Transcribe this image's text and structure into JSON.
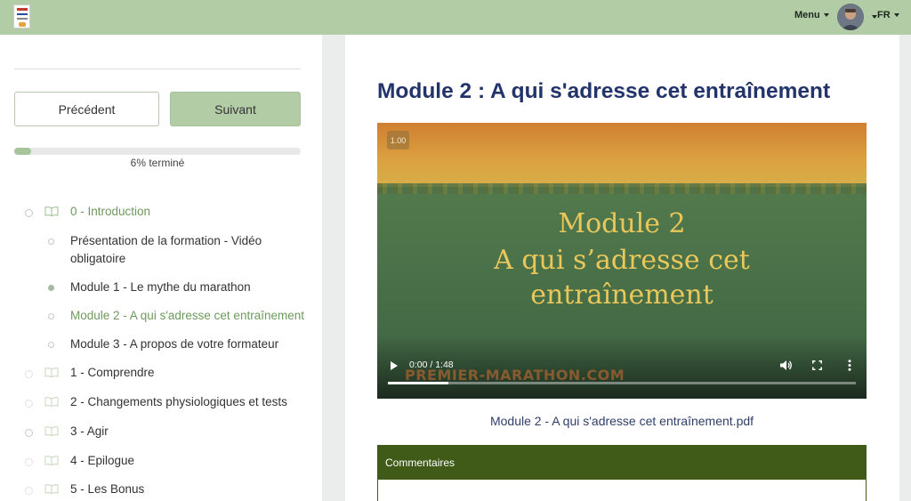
{
  "header": {
    "logo_icon": "course-logo",
    "menu_label": "Menu",
    "language": "FR",
    "bar_color": "#b2cca5"
  },
  "nav": {
    "prev_label": "Précédent",
    "next_label": "Suivant"
  },
  "progress": {
    "fraction": 0.06,
    "label": "6% terminé"
  },
  "curriculum": [
    {
      "label": "0 - Introduction",
      "state": "section"
    },
    {
      "label": "Présentation de la formation - Vidéo",
      "label_line2": "obligatoire",
      "state": "lesson"
    },
    {
      "label": "Module 1 - Le mythe du marathon",
      "state": "completed"
    },
    {
      "label": "Module 2 - A qui s'adresse cet entraînement",
      "state": "current"
    },
    {
      "label": "Module 3 - A propos de votre formateur",
      "state": "lesson"
    },
    {
      "label": "1 - Comprendre",
      "state": "section"
    },
    {
      "label": "2 - Changements physiologiques et tests",
      "state": "section"
    },
    {
      "label": "3 - Agir",
      "state": "section"
    },
    {
      "label": "4 - Epilogue",
      "state": "section"
    },
    {
      "label": "5 - Les Bonus",
      "state": "section"
    }
  ],
  "main": {
    "title": "Module 2 : A qui s'adresse cet entraînement",
    "video": {
      "speed": "1.00",
      "title_lines": [
        "Module 2",
        "A qui s’adresse cet",
        "entraînement"
      ],
      "time": "0:00 / 1:48",
      "watermark": "PREMIER-MARATHON.COM",
      "played_fraction": 0.13
    },
    "attachment": "Module 2 - A qui s'adresse cet entraînement.pdf",
    "comments_header": "Commentaires"
  },
  "colors": {
    "accent_green": "#6d9a5c",
    "title_blue": "#22346a",
    "comments_green": "#3f5b17"
  }
}
